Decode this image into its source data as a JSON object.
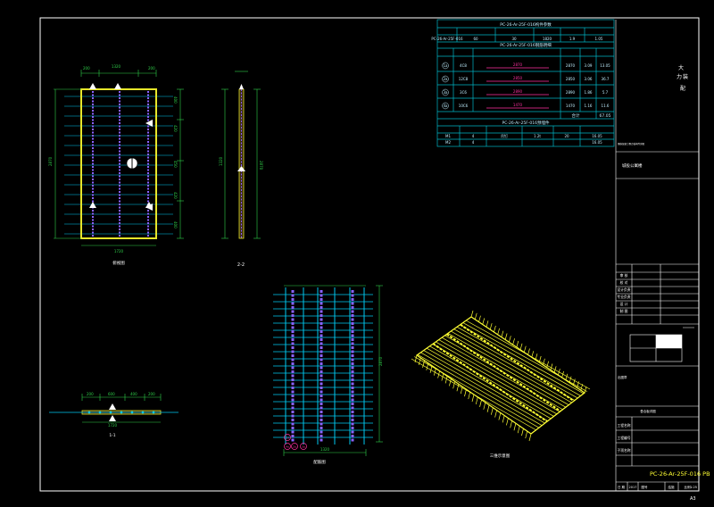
{
  "viewport": {
    "background": "#000000"
  },
  "colors": {
    "frame": "#ffffff",
    "table_border": "#00b7c7",
    "table_text": "#bfefff",
    "rebar": "#00c8f0",
    "panel_edge": "#e6e62a",
    "bar_purple": "#8a62ff",
    "dim_green": "#2fd04a",
    "magenta": "#ff2fa0",
    "iso_yellow": "#ffff33",
    "drawing_code_color": "#ffff33"
  },
  "top_table": {
    "header1": "PC-26-Ar-25F-016构件参数",
    "row1": [
      "PC-26-Ar-25F-016",
      "60",
      "30",
      "1820",
      "1.9",
      "1.05"
    ],
    "header2": "PC-26-Ar-25F-016钢筋明细",
    "rebar_rows": [
      {
        "mark": "1a",
        "spec": "4C8",
        "shape": "2870",
        "len": "2870",
        "w": "3.09",
        "t": "13.05"
      },
      {
        "mark": "2a",
        "spec": "12C8",
        "shape": "2850",
        "len": "2850",
        "w": "3.06",
        "t": "36.7"
      },
      {
        "mark": "3a",
        "spec": "3C6",
        "shape": "2890",
        "len": "2890",
        "w": "1.86",
        "t": "5.7"
      },
      {
        "mark": "4a",
        "spec": "10C6",
        "shape": "1470",
        "len": "1470",
        "w": "1.16",
        "t": "11.6"
      }
    ],
    "total_label": "合计",
    "total_value": "67.05",
    "header3": "PC-26-Ar-25F-016预埋件",
    "emb_rows": [
      [
        "M1",
        "4",
        "吊钉",
        "1.2t",
        "20",
        "16.05"
      ],
      [
        "M2",
        "4",
        "",
        "",
        "",
        "16.05"
      ]
    ]
  },
  "title_block": {
    "company": [
      "大",
      "力",
      "装",
      "配"
    ],
    "project": "城投公寓楼",
    "small_note": "钢筋混凝土叠合板构件详图",
    "rows": [
      "审  核",
      "校  对",
      "设计负责",
      "专业负责",
      "设  计",
      "制  图"
    ],
    "stamp_label": "出图章",
    "drawing_name": "叠合板详图",
    "info_rows": [
      "工程名称",
      "工程编号",
      "子项名称"
    ],
    "drawing_code": "PC-26-Ar-25F-016 PB",
    "footer": [
      "日  期",
      "2017",
      "图号",
      "结施",
      "比例",
      "1:25"
    ]
  },
  "views": {
    "plan": {
      "label": "俯视图",
      "dims_top": [
        "200",
        "1320",
        "200"
      ],
      "dim_left": "2870",
      "dim_bottom": "1720",
      "dims_right": [
        "400",
        "420",
        "450",
        "420",
        "400"
      ]
    },
    "section22": {
      "label": "2-2",
      "dim_left": "1320",
      "dim_right": "2870"
    },
    "section11": {
      "label": "1-1",
      "dims": [
        "200",
        "600",
        "400",
        "200"
      ],
      "dim_bottom": "1720"
    },
    "rebar": {
      "label": "配筋图",
      "dim_right": "2870",
      "dim_bottom": "1320",
      "marks": [
        "1a",
        "2a",
        "3a",
        "4a"
      ]
    },
    "iso": {
      "label": "三维示意图"
    }
  },
  "sheet_number": "A3"
}
